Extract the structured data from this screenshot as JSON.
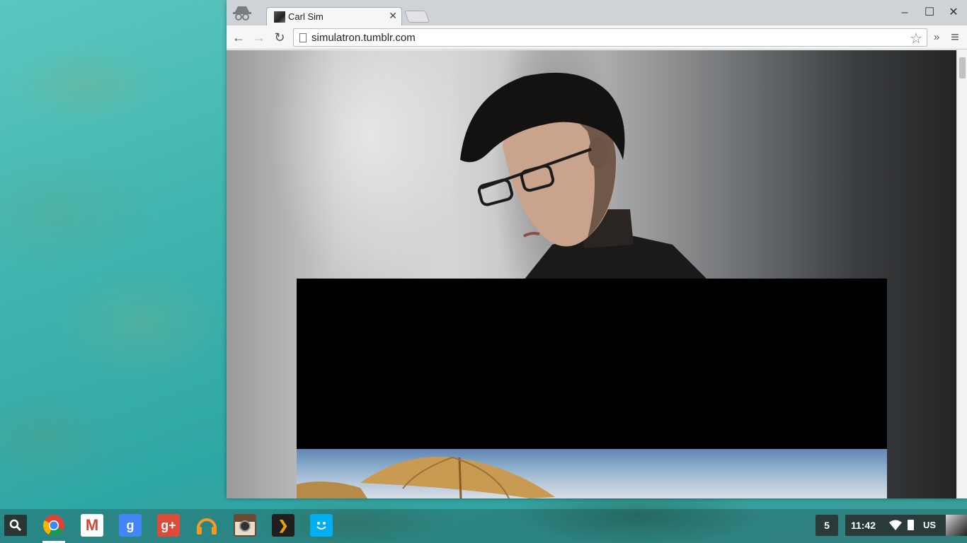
{
  "browser": {
    "tab": {
      "title": "Carl Sim",
      "close": "✕"
    },
    "window_controls": {
      "minimize": "–",
      "maximize": "☐",
      "close": "✕"
    },
    "toolbar": {
      "back": "←",
      "forward": "→",
      "reload": "↻",
      "url": "simulatron.tumblr.com",
      "overflow": "»",
      "menu": "≡"
    }
  },
  "shelf": {
    "apps": [
      {
        "name": "Chrome"
      },
      {
        "name": "Gmail"
      },
      {
        "name": "Google Search"
      },
      {
        "name": "Google+"
      },
      {
        "name": "Google Play Music"
      },
      {
        "name": "Instagram"
      },
      {
        "name": "Plex"
      },
      {
        "name": "Groupme"
      }
    ],
    "gplus_label": "g+",
    "google_label": "g",
    "gmail_label": "M",
    "plex_label": "❯",
    "notification_count": "5",
    "clock": "11:42",
    "input_method": "US"
  },
  "colors": {
    "chrome_blue": "#4285f4",
    "gmail_red": "#d44638",
    "gplus_red": "#dd4b39",
    "music_orange": "#f59a23",
    "groupme_blue": "#00aff0"
  }
}
